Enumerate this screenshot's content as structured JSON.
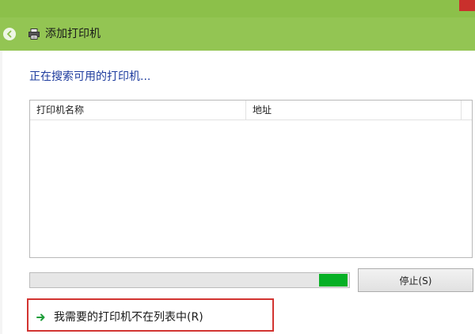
{
  "header": {
    "title": "添加打印机"
  },
  "search": {
    "status_text": "正在搜索可用的打印机..."
  },
  "table": {
    "columns": [
      "打印机名称",
      "地址"
    ],
    "rows": []
  },
  "progress": {
    "indeterminate": true,
    "segment_start": 0.905,
    "segment_length": 0.09
  },
  "buttons": {
    "stop_label": "停止(S)"
  },
  "link": {
    "not_listed_label": "我需要的打印机不在列表中(R)"
  },
  "icons": {
    "back": "back-arrow-icon",
    "printer": "printer-icon",
    "link_arrow": "green-arrow-icon"
  },
  "colors": {
    "header_bg": "#93c553",
    "title_strip": "#8cc04a",
    "status_text": "#1e3c9e",
    "progress_fill": "#06b025",
    "highlight": "#d23431"
  }
}
